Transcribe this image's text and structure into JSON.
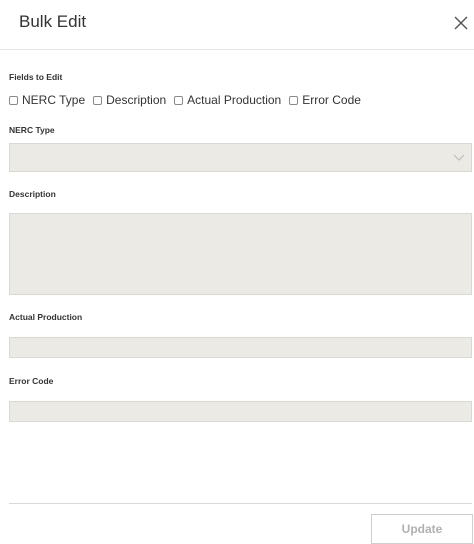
{
  "dialog": {
    "title": "Bulk Edit",
    "close_icon": "close-icon"
  },
  "fields_to_edit": {
    "label": "Fields to Edit",
    "options": [
      {
        "label": "NERC Type",
        "checked": false
      },
      {
        "label": "Description",
        "checked": false
      },
      {
        "label": "Actual Production",
        "checked": false
      },
      {
        "label": "Error Code",
        "checked": false
      }
    ]
  },
  "form": {
    "nerc_type": {
      "label": "NERC Type",
      "value": "",
      "icon": "chevron-down-icon",
      "disabled": true
    },
    "description": {
      "label": "Description",
      "value": "",
      "disabled": true
    },
    "actual_production": {
      "label": "Actual Production",
      "value": "",
      "disabled": true
    },
    "error_code": {
      "label": "Error Code",
      "value": "",
      "disabled": true
    }
  },
  "footer": {
    "update_label": "Update",
    "update_disabled": true
  },
  "colors": {
    "field_background": "#ebeae5",
    "disabled_text": "#b0b0b0"
  }
}
